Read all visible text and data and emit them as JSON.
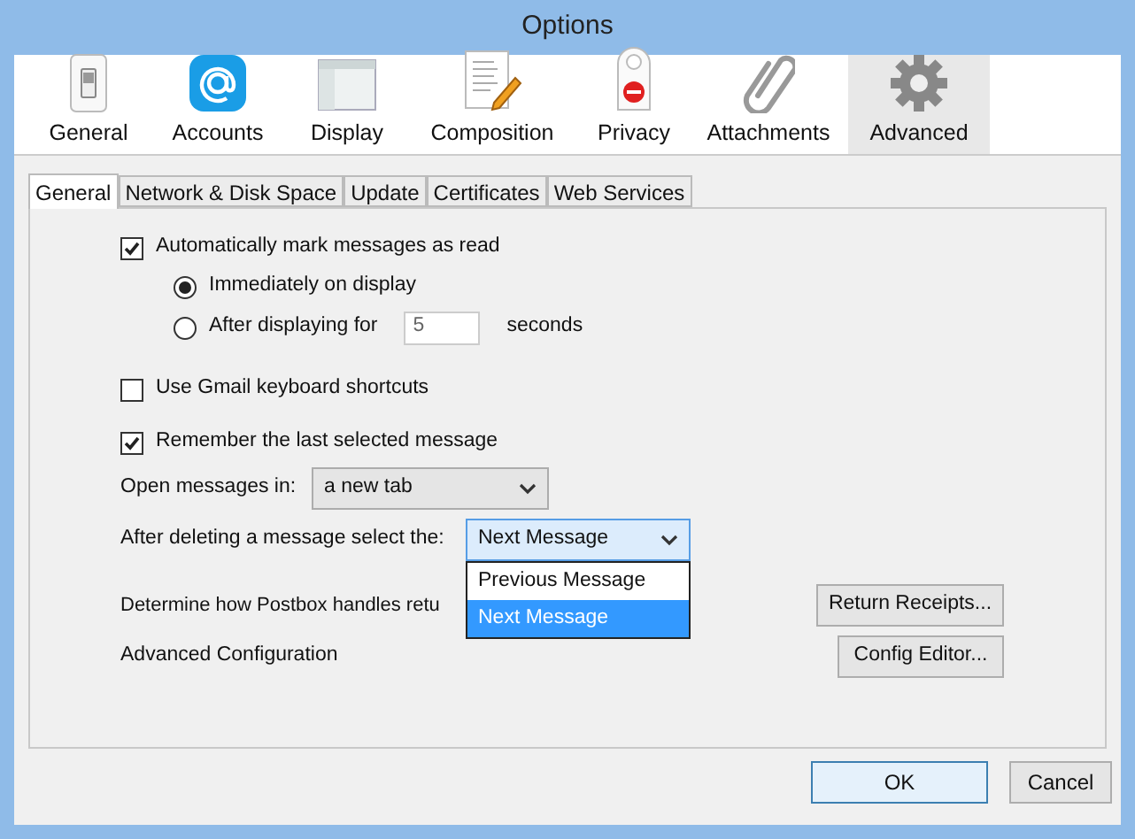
{
  "window": {
    "title": "Options"
  },
  "toolbar": [
    {
      "label": "General",
      "selected": false
    },
    {
      "label": "Accounts",
      "selected": false
    },
    {
      "label": "Display",
      "selected": false
    },
    {
      "label": "Composition",
      "selected": false
    },
    {
      "label": "Privacy",
      "selected": false
    },
    {
      "label": "Attachments",
      "selected": false
    },
    {
      "label": "Advanced",
      "selected": true
    }
  ],
  "tabs": [
    {
      "label": "General",
      "selected": true
    },
    {
      "label": "Network & Disk Space",
      "selected": false
    },
    {
      "label": "Update",
      "selected": false
    },
    {
      "label": "Certificates",
      "selected": false
    },
    {
      "label": "Web Services",
      "selected": false
    }
  ],
  "mark_read": {
    "label": "Automatically mark messages as read",
    "checked": true
  },
  "mark_read_options": [
    {
      "label": "Immediately on display",
      "selected": true
    },
    {
      "label": "After displaying for",
      "selected": false,
      "value": "5",
      "suffix": "seconds"
    }
  ],
  "gmail_shortcuts": {
    "label": "Use Gmail keyboard shortcuts",
    "checked": false
  },
  "remember_selected": {
    "label": "Remember the last selected message",
    "checked": true
  },
  "open_messages": {
    "label": "Open messages in:",
    "value": "a new tab"
  },
  "after_delete": {
    "label": "After deleting a message select the:",
    "value": "Next Message",
    "expanded": true,
    "options": [
      {
        "label": "Previous Message",
        "selected": false
      },
      {
        "label": "Next Message",
        "selected": true
      }
    ]
  },
  "receipts": {
    "label": "Determine how Postbox handles retu",
    "button": "Return Receipts..."
  },
  "advanced_config": {
    "label": "Advanced Configuration",
    "button": "Config Editor..."
  },
  "buttons": [
    "OK",
    "Cancel"
  ]
}
